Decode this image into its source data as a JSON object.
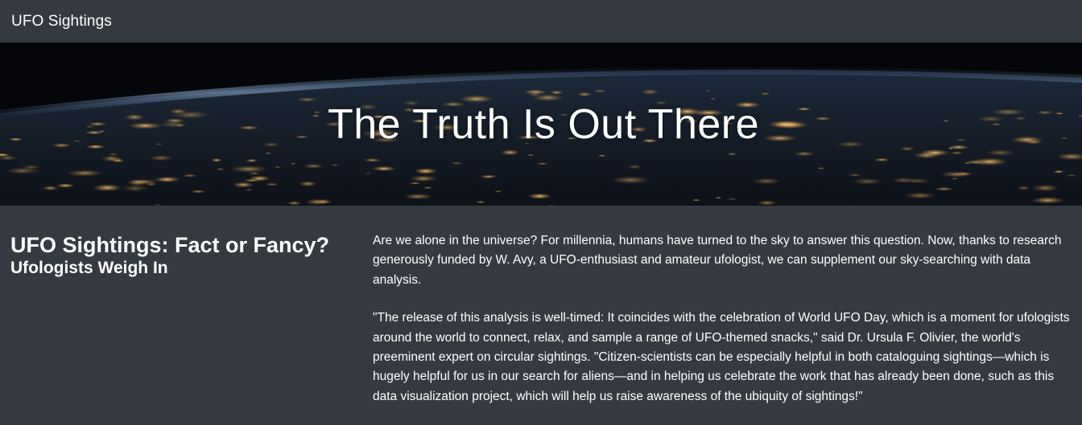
{
  "navbar": {
    "brand": "UFO Sightings"
  },
  "hero": {
    "title": "The Truth Is Out There"
  },
  "article": {
    "headline": "UFO Sightings: Fact or Fancy?",
    "subheadline": "Ufologists Weigh In",
    "paragraphs": [
      "Are we alone in the universe? For millennia, humans have turned to the sky to answer this question. Now, thanks to research generously funded by W. Avy, a UFO-enthusiast and amateur ufologist, we can supplement our sky-searching with data analysis.",
      "\"The release of this analysis is well-timed: It coincides with the celebration of World UFO Day, which is a moment for ufologists around the world to connect, relax, and sample a range of UFO-themed snacks,\" said Dr. Ursula F. Olivier, the world's preeminent expert on circular sightings. \"Citizen-scientists can be especially helpful in both cataloguing sightings—which is hugely helpful for us in our search for aliens—and in helping us celebrate the work that has already been done, such as this data visualization project, which will help us raise awareness of the ubiquity of sightings!\""
    ]
  },
  "colors": {
    "background": "#343a40",
    "text": "#ffffff",
    "hero_space": "#05070c",
    "city_lights": "#f4c46a"
  }
}
